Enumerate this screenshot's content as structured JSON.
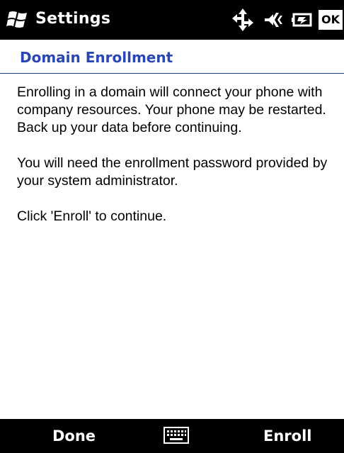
{
  "titlebar": {
    "title": "Settings",
    "start_icon": "windows-flag-icon",
    "status_icons": [
      "data-connection-icon",
      "volume-off-icon",
      "battery-charging-icon"
    ],
    "ok_label": "OK"
  },
  "section": {
    "title": "Domain Enrollment"
  },
  "content": {
    "paragraph1": "Enrolling in a domain will connect your phone with company resources. Your phone may be restarted. Back up your data before continuing.",
    "paragraph2": "You will need the enrollment password provided by your system administrator.",
    "paragraph3": "Click 'Enroll' to continue."
  },
  "softkeys": {
    "left_label": "Done",
    "center_icon": "keyboard-icon",
    "right_label": "Enroll"
  },
  "colors": {
    "bar_background": "#000000",
    "section_title": "#2a46b4",
    "divider": "#1f3c8a"
  }
}
